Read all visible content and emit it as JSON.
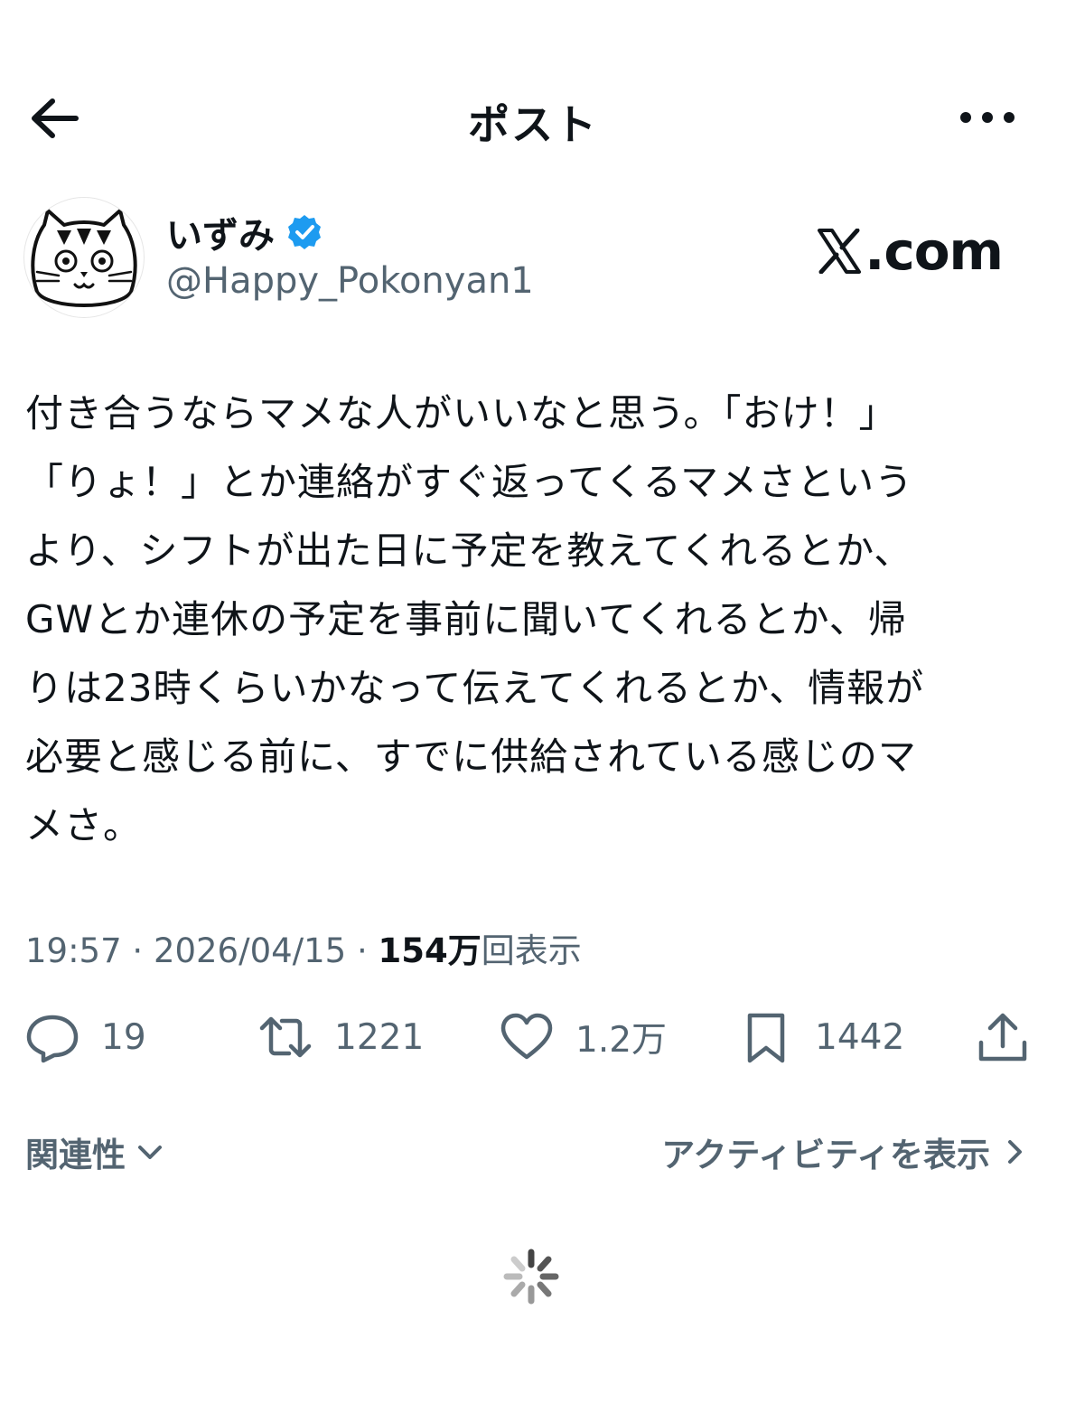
{
  "header": {
    "title": "ポスト",
    "back_icon": "arrow-left-icon",
    "more_icon": "more-horizontal-icon"
  },
  "author": {
    "display_name": "いずみ",
    "handle": "@Happy_Pokonyan1",
    "verified": true,
    "verified_color": "#1d9bf0",
    "avatar_icon": "cat-face-icon"
  },
  "brand": {
    "suffix": ".com"
  },
  "tweet": {
    "lines": [
      "付き合うならマメな人がいいなと思う。「おけ！」",
      "「りょ！」とか連絡がすぐ返ってくるマメさという",
      "より、シフトが出た日に予定を教えてくれるとか、",
      "GWとか連休の予定を事前に聞いてくれるとか、帰",
      "りは23時くらいかなって伝えてくれるとか、情報が",
      "必要と感じる前に、すでに供給されている感じのマ",
      "メさ。"
    ]
  },
  "meta": {
    "time": "19:57",
    "date": "2026/04/15",
    "views": "154万",
    "views_label": "回表示"
  },
  "actions": {
    "replies": "19",
    "retweets": "1221",
    "likes": "1.2万",
    "bookmarks": "1442"
  },
  "footer": {
    "relevance_label": "関連性",
    "activity_label": "アクティビティを表示"
  },
  "colors": {
    "text": "#0f1419",
    "secondary": "#536471",
    "accent": "#1d9bf0"
  }
}
